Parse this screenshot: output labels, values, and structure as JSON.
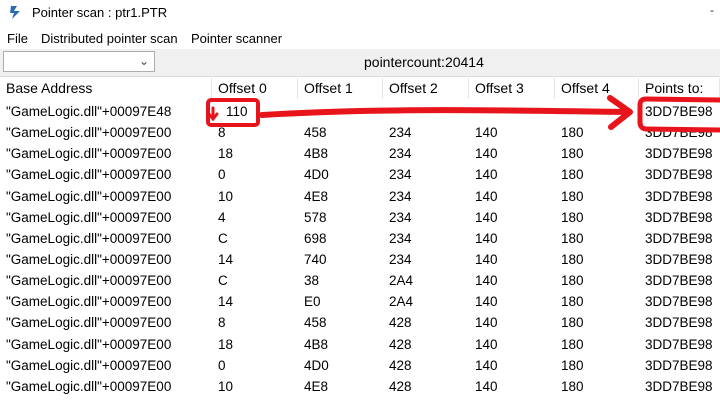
{
  "window": {
    "title": "Pointer scan : ptr1.PTR",
    "corner": "-"
  },
  "menu": {
    "items": [
      "File",
      "Distributed pointer scan",
      "Pointer scanner"
    ]
  },
  "toolbar": {
    "combo_value": "",
    "count_label": "pointercount:20414"
  },
  "table": {
    "columns": [
      "Base Address",
      "Offset 0",
      "Offset 1",
      "Offset 2",
      "Offset 3",
      "Offset 4",
      "Points to:"
    ],
    "rows": [
      [
        "\"GameLogic.dll\"+00097E48",
        "110",
        "",
        "",
        "",
        "",
        "3DD7BE98"
      ],
      [
        "\"GameLogic.dll\"+00097E00",
        "8",
        "458",
        "234",
        "140",
        "180",
        "3DD7BE98"
      ],
      [
        "\"GameLogic.dll\"+00097E00",
        "18",
        "4B8",
        "234",
        "140",
        "180",
        "3DD7BE98"
      ],
      [
        "\"GameLogic.dll\"+00097E00",
        "0",
        "4D0",
        "234",
        "140",
        "180",
        "3DD7BE98"
      ],
      [
        "\"GameLogic.dll\"+00097E00",
        "10",
        "4E8",
        "234",
        "140",
        "180",
        "3DD7BE98"
      ],
      [
        "\"GameLogic.dll\"+00097E00",
        "4",
        "578",
        "234",
        "140",
        "180",
        "3DD7BE98"
      ],
      [
        "\"GameLogic.dll\"+00097E00",
        "C",
        "698",
        "234",
        "140",
        "180",
        "3DD7BE98"
      ],
      [
        "\"GameLogic.dll\"+00097E00",
        "14",
        "740",
        "234",
        "140",
        "180",
        "3DD7BE98"
      ],
      [
        "\"GameLogic.dll\"+00097E00",
        "C",
        "38",
        "2A4",
        "140",
        "180",
        "3DD7BE98"
      ],
      [
        "\"GameLogic.dll\"+00097E00",
        "14",
        "E0",
        "2A4",
        "140",
        "180",
        "3DD7BE98"
      ],
      [
        "\"GameLogic.dll\"+00097E00",
        "8",
        "458",
        "428",
        "140",
        "180",
        "3DD7BE98"
      ],
      [
        "\"GameLogic.dll\"+00097E00",
        "18",
        "4B8",
        "428",
        "140",
        "180",
        "3DD7BE98"
      ],
      [
        "\"GameLogic.dll\"+00097E00",
        "0",
        "4D0",
        "428",
        "140",
        "180",
        "3DD7BE98"
      ],
      [
        "\"GameLogic.dll\"+00097E00",
        "10",
        "4E8",
        "428",
        "140",
        "180",
        "3DD7BE98"
      ]
    ]
  },
  "annotation": {
    "color": "#e8141b"
  }
}
